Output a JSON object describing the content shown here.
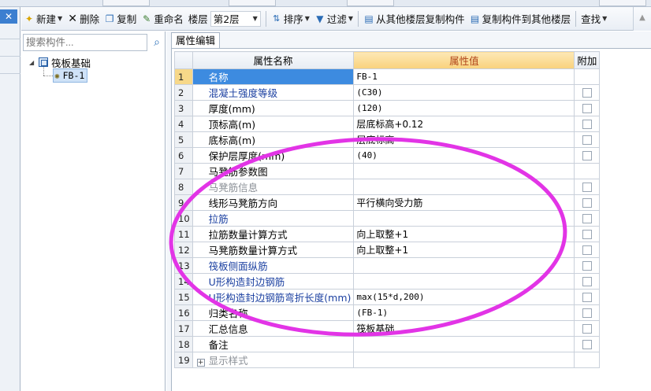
{
  "toolbar": {
    "new_label": "新建",
    "delete_label": "删除",
    "copy_label": "复制",
    "rename_label": "重命名",
    "floor_label": "楼层",
    "floor_value": "第2层",
    "sort_label": "排序",
    "filter_label": "过滤",
    "copy_from_label": "从其他楼层复制构件",
    "copy_to_label": "复制构件到其他楼层",
    "find_label": "查找"
  },
  "search": {
    "placeholder": "搜索构件..."
  },
  "tree": {
    "root_label": "筏板基础",
    "child_label": "FB-1"
  },
  "panel": {
    "tab_label": "属性编辑"
  },
  "grid": {
    "headers": {
      "name": "属性名称",
      "value": "属性值",
      "add": "附加"
    },
    "rows": [
      {
        "num": "1",
        "name": "名称",
        "value": "FB-1",
        "style": "cat",
        "checkbox": false
      },
      {
        "num": "2",
        "name": "混凝土强度等级",
        "value": "(C30)",
        "style": "cat",
        "checkbox": true
      },
      {
        "num": "3",
        "name": "厚度(mm)",
        "value": "(120)",
        "style": "",
        "checkbox": true
      },
      {
        "num": "4",
        "name": "顶标高(m)",
        "value": "层底标高+0.12",
        "style": "",
        "checkbox": true
      },
      {
        "num": "5",
        "name": "底标高(m)",
        "value": "层底标高",
        "style": "",
        "checkbox": true
      },
      {
        "num": "6",
        "name": "保护层厚度(mm)",
        "value": "(40)",
        "style": "",
        "checkbox": true
      },
      {
        "num": "7",
        "name": "马凳筋参数图",
        "value": "",
        "style": "",
        "checkbox": false
      },
      {
        "num": "8",
        "name": "马凳筋信息",
        "value": "",
        "style": "grey",
        "checkbox": true
      },
      {
        "num": "9",
        "name": "线形马凳筋方向",
        "value": "平行横向受力筋",
        "style": "",
        "checkbox": true
      },
      {
        "num": "10",
        "name": "拉筋",
        "value": "",
        "style": "cat",
        "checkbox": true
      },
      {
        "num": "11",
        "name": "拉筋数量计算方式",
        "value": "向上取整+1",
        "style": "",
        "checkbox": true
      },
      {
        "num": "12",
        "name": "马凳筋数量计算方式",
        "value": "向上取整+1",
        "style": "",
        "checkbox": true
      },
      {
        "num": "13",
        "name": "筏板侧面纵筋",
        "value": "",
        "style": "cat",
        "checkbox": true
      },
      {
        "num": "14",
        "name": "U形构造封边钢筋",
        "value": "",
        "style": "cat",
        "checkbox": true
      },
      {
        "num": "15",
        "name": "U形构造封边钢筋弯折长度(mm)",
        "value": "max(15*d,200)",
        "style": "cat",
        "checkbox": true
      },
      {
        "num": "16",
        "name": "归类名称",
        "value": "(FB-1)",
        "style": "",
        "checkbox": true
      },
      {
        "num": "17",
        "name": "汇总信息",
        "value": "筏板基础",
        "style": "",
        "checkbox": true
      },
      {
        "num": "18",
        "name": "备注",
        "value": "",
        "style": "",
        "checkbox": true
      },
      {
        "num": "19",
        "name": "显示样式",
        "value": "",
        "style": "grey",
        "checkbox": false,
        "expandable": true
      }
    ]
  },
  "colors": {
    "annotation_ellipse": "#e234e6",
    "selection": "#3d8be0",
    "value_header": "#f9d27c"
  }
}
